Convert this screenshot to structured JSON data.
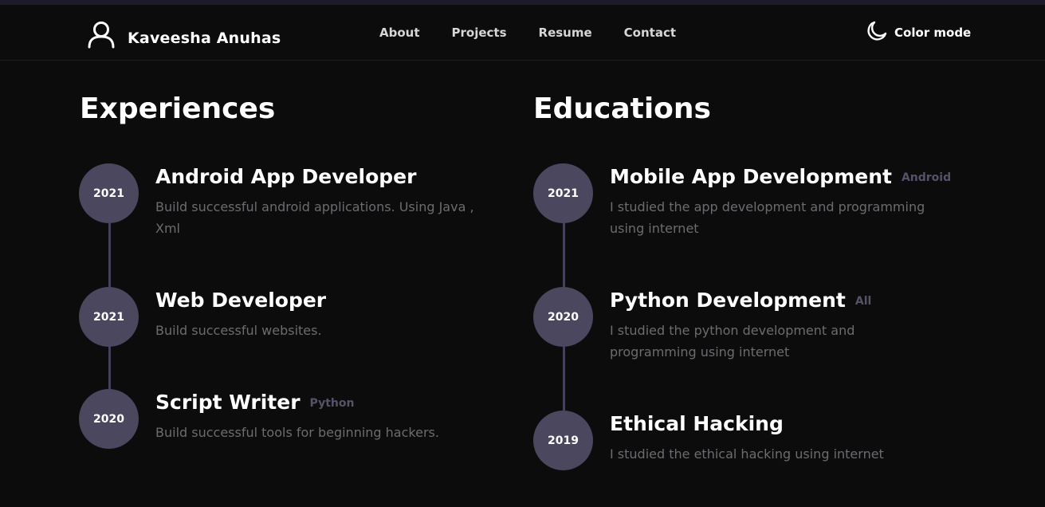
{
  "header": {
    "brand_name": "Kaveesha Anuhas",
    "nav": [
      "About",
      "Projects",
      "Resume",
      "Contact"
    ],
    "color_mode_label": "Color mode"
  },
  "experiences": {
    "title": "Experiences",
    "items": [
      {
        "year": "2021",
        "title": "Android App Developer",
        "tag": "",
        "desc": "Build successful android applications. Using Java , Xml"
      },
      {
        "year": "2021",
        "title": "Web Developer",
        "tag": "",
        "desc": "Build successful websites."
      },
      {
        "year": "2020",
        "title": "Script Writer",
        "tag": "Python",
        "desc": "Build successful tools for beginning hackers."
      }
    ]
  },
  "educations": {
    "title": "Educations",
    "items": [
      {
        "year": "2021",
        "title": "Mobile App Development",
        "tag": "Android",
        "desc": "I studied the app development and programming using internet"
      },
      {
        "year": "2020",
        "title": "Python Development",
        "tag": "All",
        "desc": "I studied the python development and programming using internet"
      },
      {
        "year": "2019",
        "title": "Ethical Hacking",
        "tag": "",
        "desc": "I studied the ethical hacking using internet"
      }
    ]
  },
  "colors": {
    "background": "#0c0c0d",
    "dot": "#4a475e",
    "line": "#44415a",
    "tag": "#55526a",
    "desc": "#6c6c70"
  },
  "icons": {
    "brand": "user-icon",
    "color_mode": "moon-icon"
  }
}
